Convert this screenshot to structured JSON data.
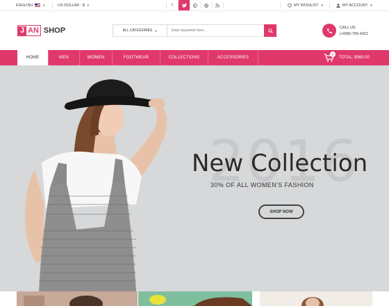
{
  "topbar": {
    "language": "ENGLISH",
    "currency": "US DOLLAR : $",
    "wishlist": "MY WISHLIST",
    "account": "MY ACCOUNT",
    "social": [
      "f",
      "t",
      "p",
      "d",
      "r"
    ]
  },
  "header": {
    "logo_j": "J",
    "logo_an": "AN",
    "logo_shop": "SHOP",
    "search": {
      "category": "ALL CATEGORIES",
      "placeholder": "Enter keywords here..."
    },
    "call_label": "CALL US",
    "call_number": "(+098)-765-4321"
  },
  "nav": {
    "items": [
      "HOME",
      "MEN",
      "WOMEN",
      "FOOTWEAR",
      "COLLECTIONS",
      "ACCESSORIES"
    ],
    "active": "HOME",
    "cart_count": "0",
    "cart_total": "TOTAL: $560.00"
  },
  "hero": {
    "year": "2016",
    "title": "New Collection",
    "subtitle": "30% OF ALL WOMEN'S FASHION",
    "button": "SHOP NOW"
  },
  "colors": {
    "accent": "#e0386a",
    "hero_bg": "#d6d8da"
  }
}
